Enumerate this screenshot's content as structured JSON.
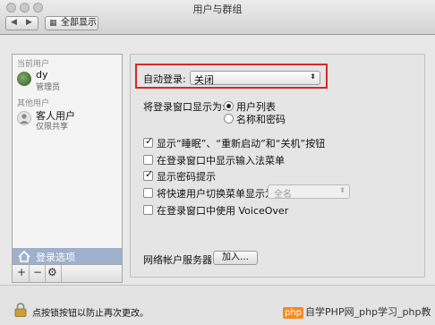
{
  "window": {
    "title": "用户与群组"
  },
  "toolbar": {
    "back_glyph": "◀",
    "forward_glyph": "▶",
    "show_all_label": "全部显示"
  },
  "sidebar": {
    "current_users_header": "当前用户",
    "other_users_header": "其他用户",
    "users": [
      {
        "name": "dy",
        "role": "管理员",
        "avatar_color": "#3f6e34"
      },
      {
        "name": "客人用户",
        "role": "仅限共享",
        "avatar_color": "#d9d9d9"
      }
    ],
    "login_options_label": "登录选项",
    "add_glyph": "+",
    "remove_glyph": "−",
    "gear_glyph": "⚙"
  },
  "main": {
    "auto_login": {
      "label": "自动登录:",
      "value": "关闭"
    },
    "display_login_window": {
      "label": "将登录窗口显示为:",
      "options": [
        {
          "label": "用户列表",
          "selected": true
        },
        {
          "label": "名称和密码",
          "selected": false
        }
      ]
    },
    "checkboxes": [
      {
        "label": "显示“睡眠”、“重新启动”和“关机”按钮",
        "checked": true
      },
      {
        "label": "在登录窗口中显示输入法菜单",
        "checked": false
      },
      {
        "label": "显示密码提示",
        "checked": true
      },
      {
        "label": "将快速用户切换菜单显示为",
        "checked": false
      },
      {
        "label": "在登录窗口中使用 VoiceOver",
        "checked": false
      }
    ],
    "fast_user_switch_display": "全名",
    "network_account_server": {
      "label": "网络帐户服务器:",
      "button": "加入…"
    }
  },
  "footer": {
    "lock_text": "点按锁按钮以防止再次更改。"
  },
  "watermark": {
    "logo": "php",
    "text": "自学PHP网_php学习_php教"
  },
  "colors": {
    "highlight_frame": "#d32a2a",
    "sidebar_selection": "#9fb0cc"
  }
}
